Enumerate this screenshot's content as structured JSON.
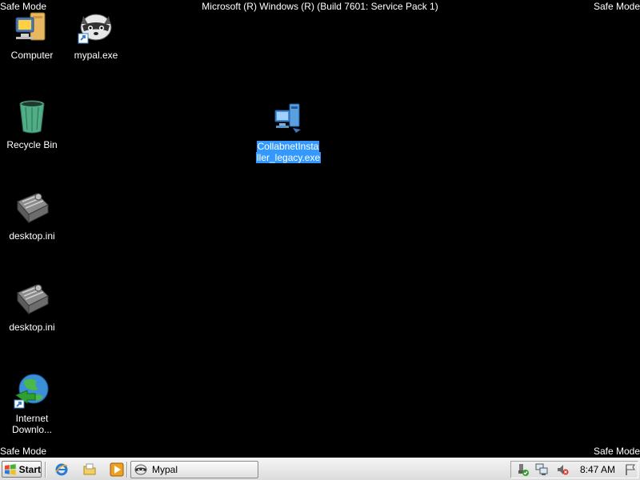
{
  "window_title": "Microsoft (R) Windows (R) (Build 7601: Service Pack 1)",
  "corners": {
    "top_left": "Safe Mode",
    "top_right": "Safe Mode",
    "bottom_left": "Safe Mode",
    "bottom_right": "Safe Mode"
  },
  "desktop_icons": {
    "computer": "Computer",
    "mypal": "mypal.exe",
    "recycle_bin": "Recycle Bin",
    "collabnet_line1": "CollabnetInsta",
    "collabnet_line2": "ller_legacy.exe",
    "desktop_ini_1": "desktop.ini",
    "desktop_ini_2": "desktop.ini",
    "idm_line1": "Internet",
    "idm_line2": "Downlo..."
  },
  "taskbar": {
    "start_label": "Start",
    "quick_launch": [
      "ie-icon",
      "folder-icon",
      "media-player-icon"
    ],
    "tasks": [
      {
        "label": "Mypal",
        "icon": "raccoon-icon"
      }
    ],
    "tray_icons": [
      "safely-remove-icon",
      "network-icon",
      "volume-muted-icon"
    ],
    "clock": "8:47 AM"
  },
  "colors": {
    "desktop_bg": "#000000",
    "selection": "#3399ff",
    "text": "#ffffff"
  }
}
